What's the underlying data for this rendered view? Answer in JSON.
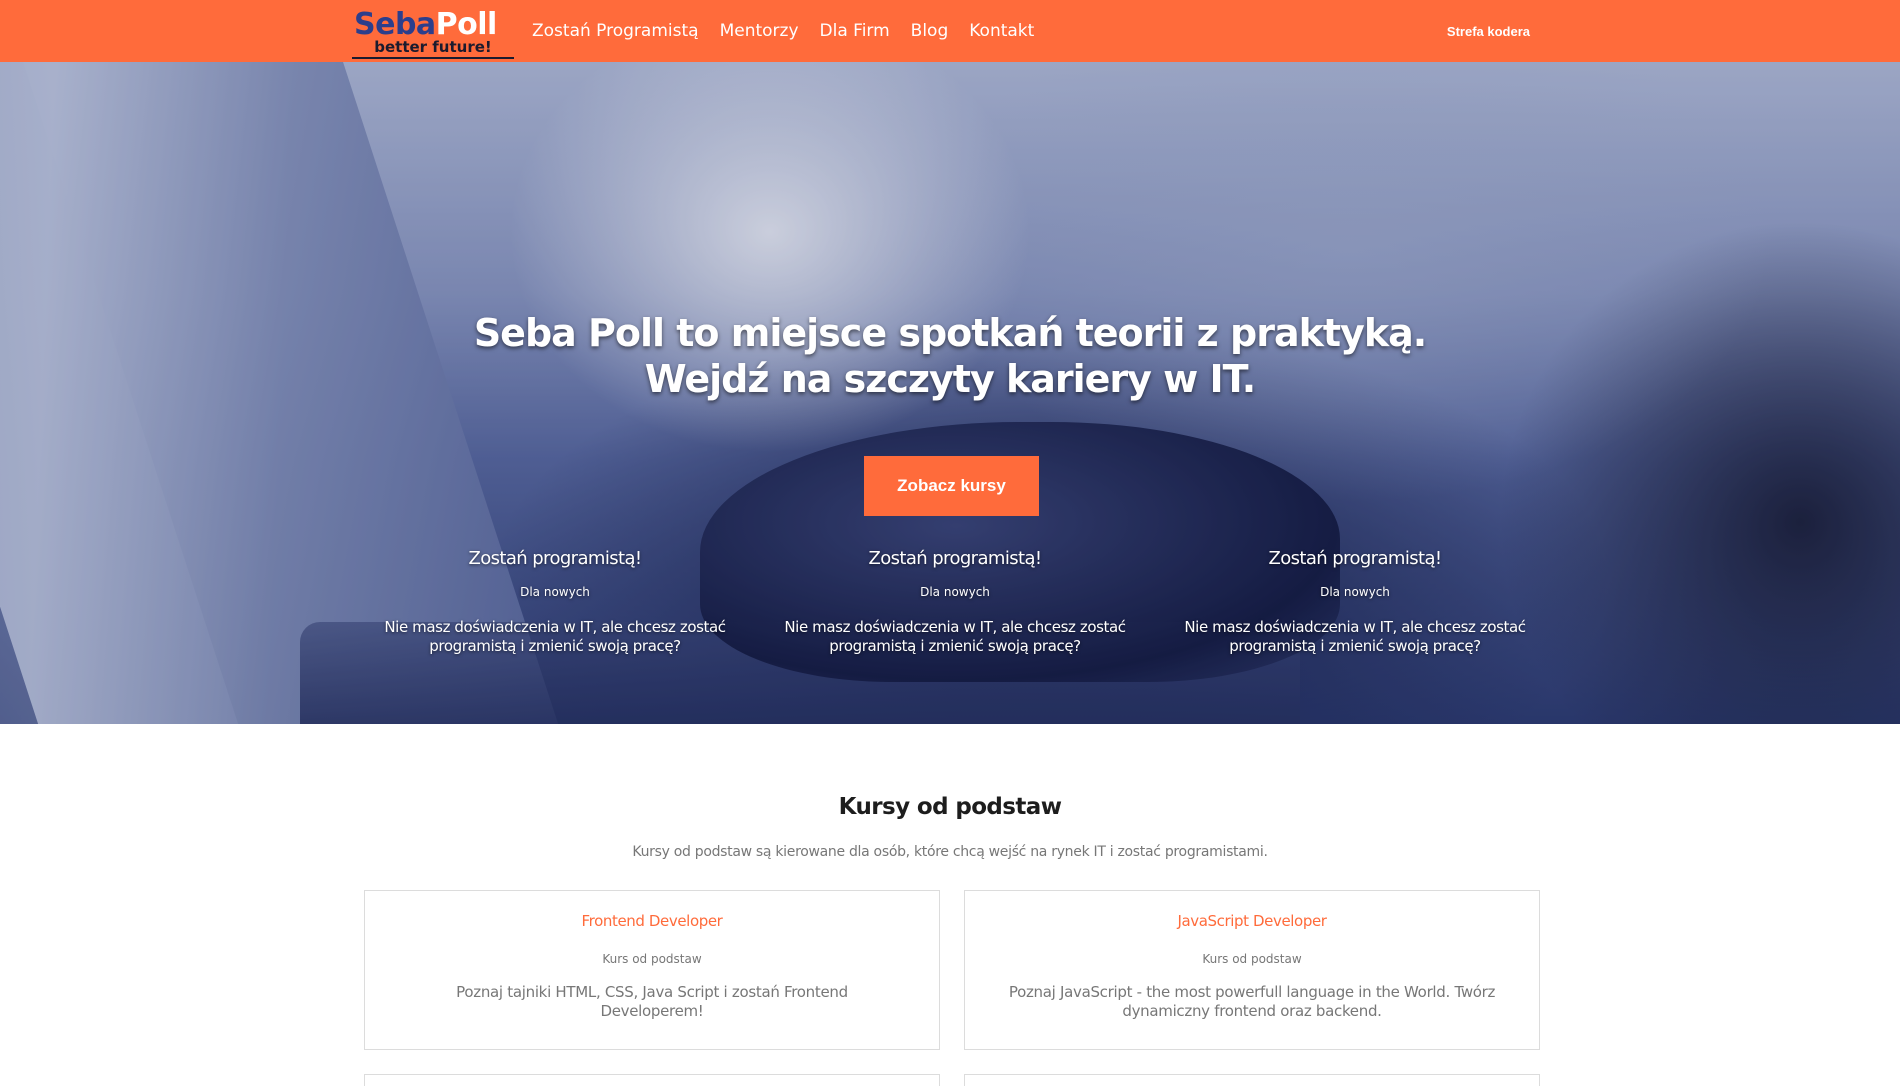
{
  "header": {
    "logo": {
      "part1": "Seba",
      "part2": "Poll",
      "tagline": "better future!"
    },
    "nav": [
      {
        "label": "Zostań Programistą"
      },
      {
        "label": "Mentorzy"
      },
      {
        "label": "Dla Firm"
      },
      {
        "label": "Blog"
      },
      {
        "label": "Kontakt"
      }
    ],
    "right_link": "Strefa kodera"
  },
  "hero": {
    "title_line1": "Seba Poll to miejsce spotkań teorii z praktyką.",
    "title_line2": "Wejdź na szczyty kariery w IT.",
    "cta": "Zobacz kursy",
    "features": [
      {
        "title": "Zostań programistą!",
        "tag": "Dla nowych",
        "text": "Nie masz doświadczenia w IT, ale chcesz zostać programistą i zmienić swoją pracę?"
      },
      {
        "title": "Zostań programistą!",
        "tag": "Dla nowych",
        "text": "Nie masz doświadczenia w IT, ale chcesz zostać programistą i zmienić swoją pracę?"
      },
      {
        "title": "Zostań programistą!",
        "tag": "Dla nowych",
        "text": "Nie masz doświadczenia w IT, ale chcesz zostać programistą i zmienić swoją pracę?"
      }
    ]
  },
  "courses": {
    "title": "Kursy od podstaw",
    "subtitle": "Kursy od podstaw są kierowane dla osób, które chcą wejść na rynek IT i zostać programistami.",
    "cards": [
      {
        "title": "Frontend Developer",
        "tag": "Kurs od podstaw",
        "text": "Poznaj tajniki HTML, CSS, Java Script i zostań Frontend Developerem!"
      },
      {
        "title": "JavaScript Developer",
        "tag": "Kurs od podstaw",
        "text": "Poznaj JavaScript - the most powerfull language in the World. Twórz dynamiczny frontend oraz backend."
      }
    ]
  },
  "colors": {
    "accent": "#ff6b3b",
    "logo_blue": "#2c3e8c"
  }
}
